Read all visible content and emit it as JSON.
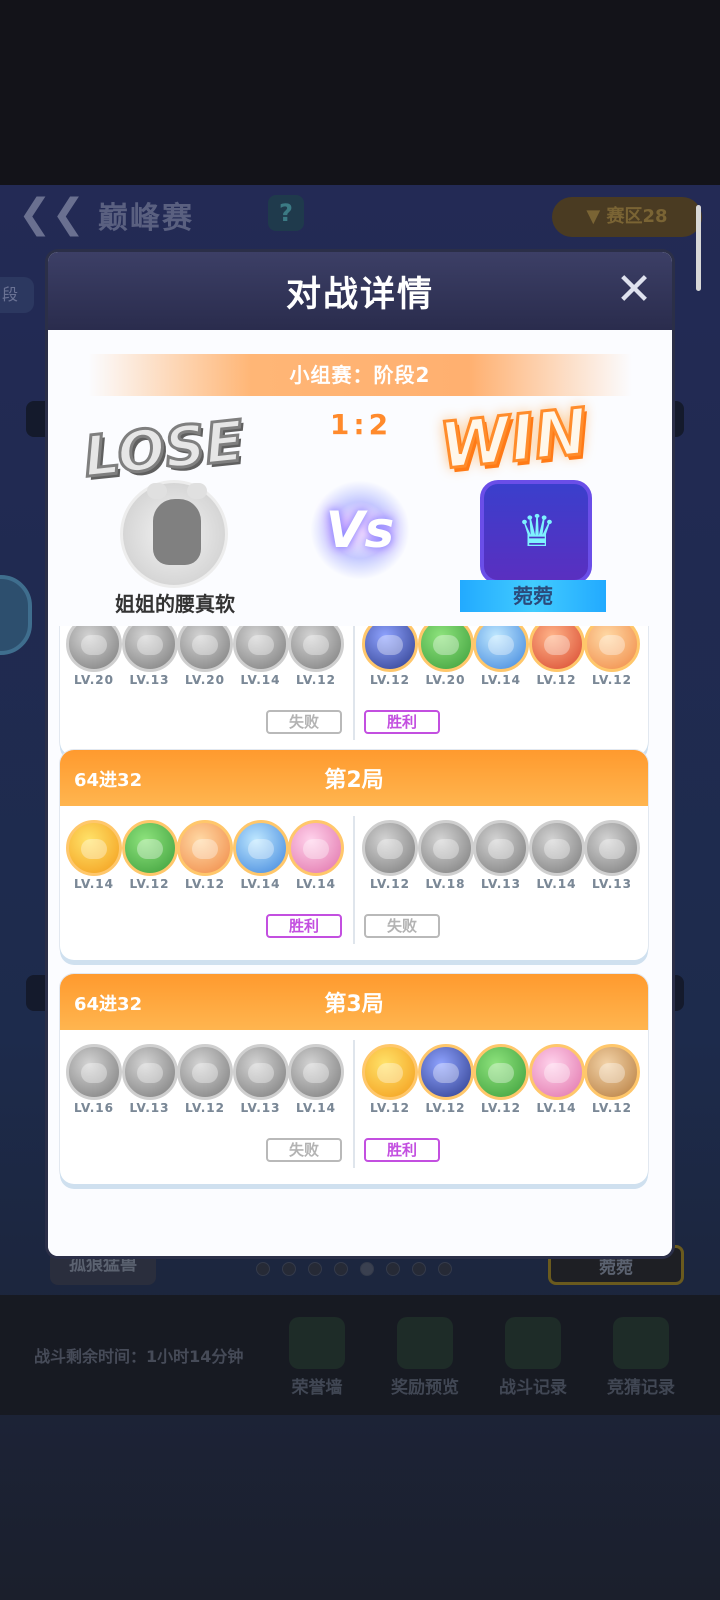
{
  "background": {
    "title": "巅峰赛",
    "help_icon": "question-icon",
    "region": "▼ 赛区28",
    "stage_tag": "段",
    "bottom_left_button": "孤狼猛兽",
    "bottom_right_button": "菀菀",
    "timer": "战斗剩余时间：1小时14分钟",
    "nav": [
      {
        "label": "荣誉墙",
        "icon": "trophy-icon"
      },
      {
        "label": "奖励预览",
        "icon": "gift-icon"
      },
      {
        "label": "战斗记录",
        "icon": "swords-icon"
      },
      {
        "label": "竞猜记录",
        "icon": "note-icon"
      }
    ]
  },
  "modal": {
    "title": "对战详情",
    "close_icon": "close-icon",
    "stage": "小组赛：阶段2",
    "score": "1:2",
    "left_player": {
      "result": "LOSE",
      "name": "姐姐的腰真软"
    },
    "right_player": {
      "result": "WIN",
      "name": "菀菀"
    },
    "vs": "Vs"
  },
  "rounds": [
    {
      "stage": "",
      "title": "",
      "left_heroes": [
        {
          "level": "LV.20",
          "color": "gray"
        },
        {
          "level": "LV.13",
          "color": "gray"
        },
        {
          "level": "LV.20",
          "color": "gray"
        },
        {
          "level": "LV.14",
          "color": "gray"
        },
        {
          "level": "LV.12",
          "color": "gray"
        }
      ],
      "right_heroes": [
        {
          "level": "LV.12",
          "color": "c-navy"
        },
        {
          "level": "LV.20",
          "color": "c-green"
        },
        {
          "level": "LV.14",
          "color": "c-blue"
        },
        {
          "level": "LV.12",
          "color": "c-red"
        },
        {
          "level": "LV.12",
          "color": "c-orange"
        }
      ],
      "left_result": "失败",
      "right_result": "胜利",
      "left_win": false
    },
    {
      "stage": "64进32",
      "title": "第2局",
      "left_heroes": [
        {
          "level": "LV.14",
          "color": "c-yellow"
        },
        {
          "level": "LV.12",
          "color": "c-green"
        },
        {
          "level": "LV.12",
          "color": "c-orange"
        },
        {
          "level": "LV.14",
          "color": "c-blue"
        },
        {
          "level": "LV.14",
          "color": "c-pink"
        }
      ],
      "right_heroes": [
        {
          "level": "LV.12",
          "color": "gray"
        },
        {
          "level": "LV.18",
          "color": "gray"
        },
        {
          "level": "LV.13",
          "color": "gray"
        },
        {
          "level": "LV.14",
          "color": "gray"
        },
        {
          "level": "LV.13",
          "color": "gray"
        }
      ],
      "left_result": "胜利",
      "right_result": "失败",
      "left_win": true
    },
    {
      "stage": "64进32",
      "title": "第3局",
      "left_heroes": [
        {
          "level": "LV.16",
          "color": "gray"
        },
        {
          "level": "LV.13",
          "color": "gray"
        },
        {
          "level": "LV.12",
          "color": "gray"
        },
        {
          "level": "LV.13",
          "color": "gray"
        },
        {
          "level": "LV.14",
          "color": "gray"
        }
      ],
      "right_heroes": [
        {
          "level": "LV.12",
          "color": "c-yellow"
        },
        {
          "level": "LV.12",
          "color": "c-navy"
        },
        {
          "level": "LV.12",
          "color": "c-green"
        },
        {
          "level": "LV.14",
          "color": "c-pink"
        },
        {
          "level": "LV.12",
          "color": "c-brown"
        }
      ],
      "left_result": "失败",
      "right_result": "胜利",
      "left_win": false
    }
  ]
}
